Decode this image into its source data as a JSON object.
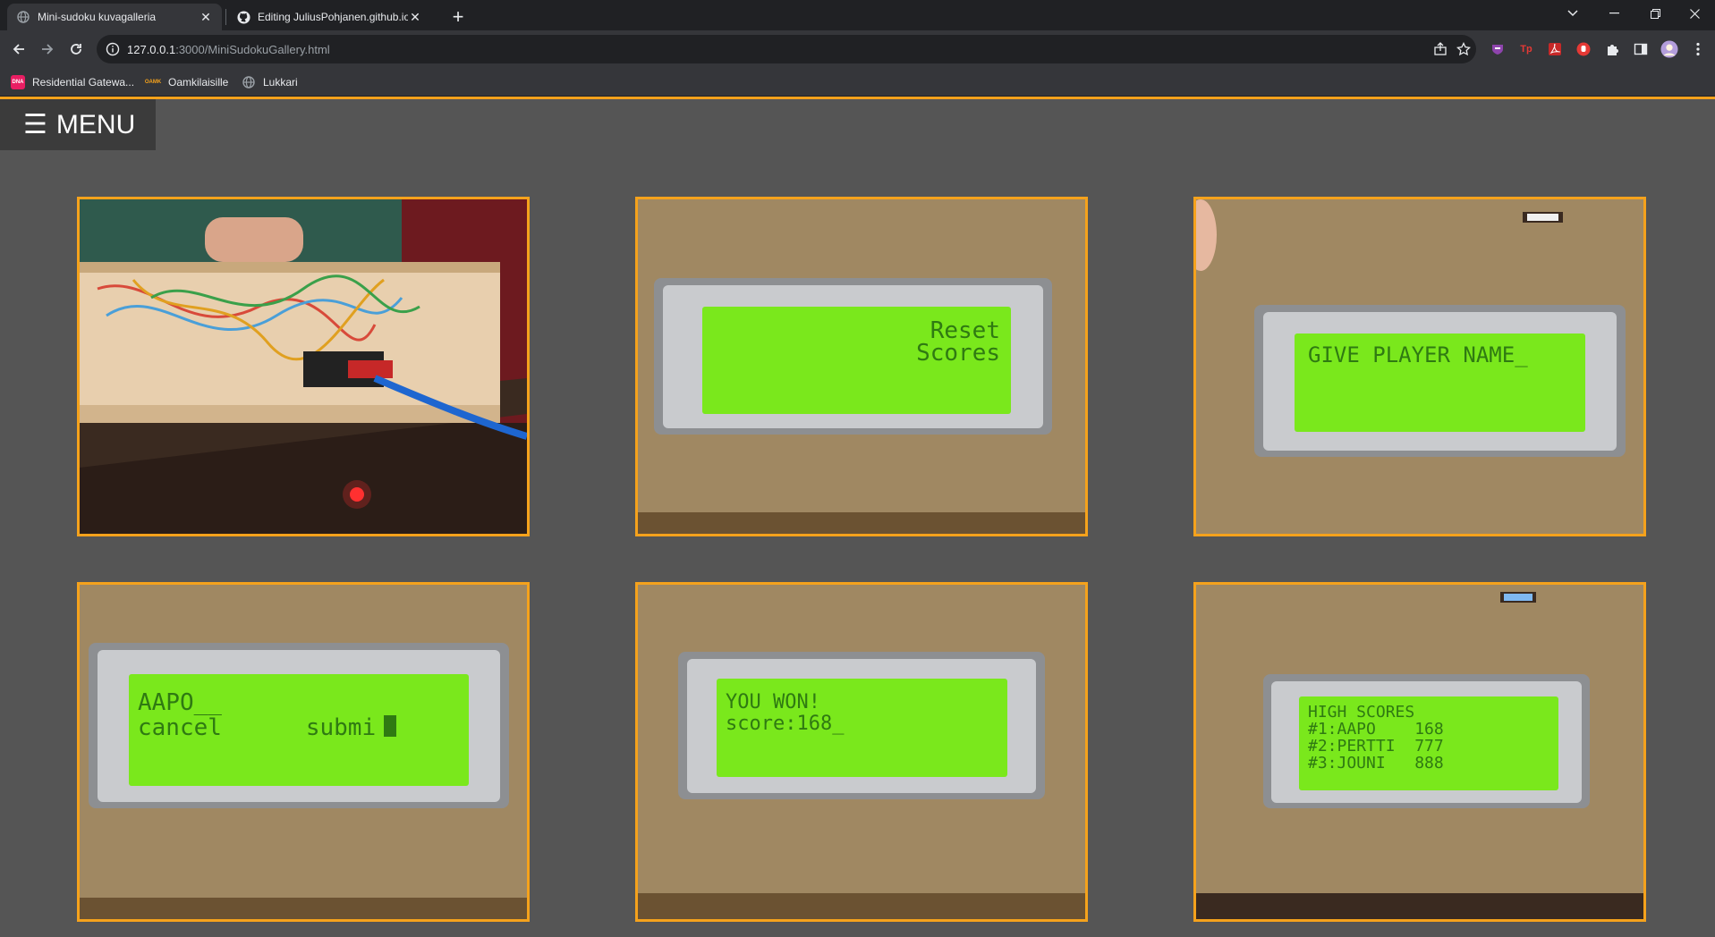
{
  "browser": {
    "tabs": [
      {
        "title": "Mini-sudoku kuvagalleria",
        "close": "✕",
        "active": true
      },
      {
        "title": "Editing JuliusPohjanen.github.io/",
        "close": "✕",
        "active": false
      }
    ],
    "new_tab": "+",
    "address": {
      "host": "127.0.0.1",
      "path": ":3000/MiniSudokuGallery.html"
    },
    "bookmarks": [
      {
        "label": "Residential Gatewa...",
        "icon_text": "DNA"
      },
      {
        "label": "Oamkilaisille",
        "icon_text": "OAMK"
      },
      {
        "label": "Lukkari",
        "icon_text": ""
      }
    ],
    "window_controls": {
      "tablist": "⌄",
      "minimize": "—",
      "restore": "❐",
      "close": "✕"
    },
    "extensions": {
      "tp": "Tp"
    }
  },
  "page": {
    "menu_label": "MENU",
    "menu_icon": "☰"
  },
  "gallery": [
    {
      "kind": "wiring",
      "lcd_lines": []
    },
    {
      "kind": "lcd",
      "lcd_lines": [
        "Reset",
        "Scores"
      ]
    },
    {
      "kind": "lcd",
      "lcd_lines": [
        "GIVE PLAYER NAME_"
      ]
    },
    {
      "kind": "lcd",
      "lcd_lines": [
        "AAPO__",
        "cancel      submi"
      ]
    },
    {
      "kind": "lcd",
      "lcd_lines": [
        "YOU WON!",
        "score:168_"
      ]
    },
    {
      "kind": "lcd",
      "lcd_lines": [
        "HIGH SCORES",
        "#1:AAPO    168",
        "#2:PERTTI  777",
        "#3:JOUNI   888"
      ]
    }
  ],
  "colors": {
    "accent": "#f5a21c",
    "page_bg": "#555555",
    "lcd_green": "#7ae81c",
    "lcd_text": "#2f7a12",
    "cardboard": "#a08862"
  }
}
